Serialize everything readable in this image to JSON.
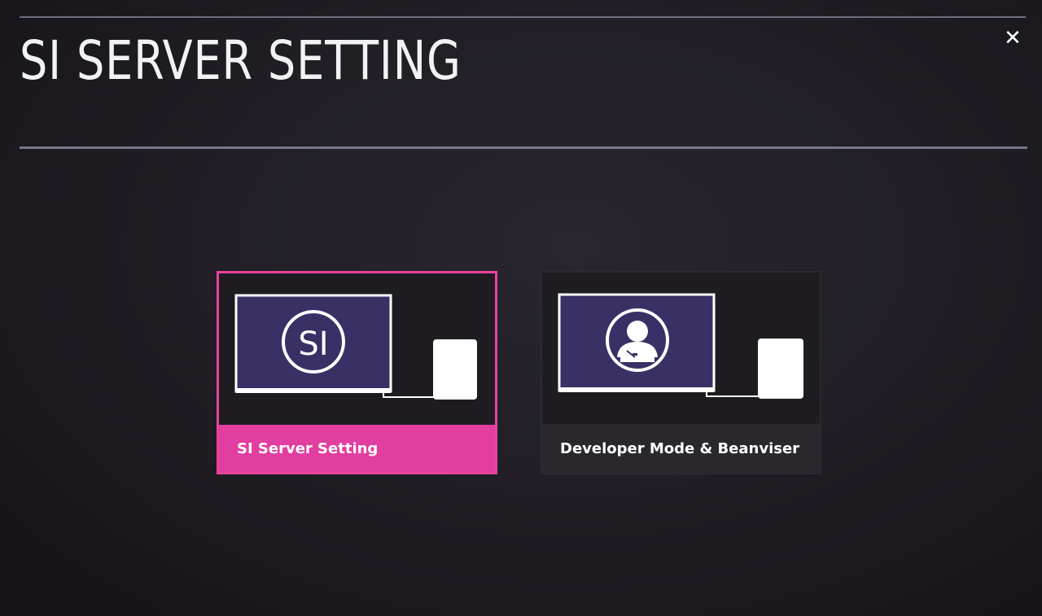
{
  "page": {
    "title": "SI SERVER SETTING",
    "close_icon_glyph": "✕"
  },
  "cards": [
    {
      "label": "SI Server Setting",
      "icon_text": "SI",
      "icon": "si-monitor-icon",
      "focused": true
    },
    {
      "label": "Developer Mode & Beanviser",
      "icon": "developer-monitor-icon",
      "focused": false
    }
  ],
  "colors": {
    "accent": "#e23ea0",
    "monitor_fill": "#3a3065",
    "background": "#1e1c21"
  }
}
